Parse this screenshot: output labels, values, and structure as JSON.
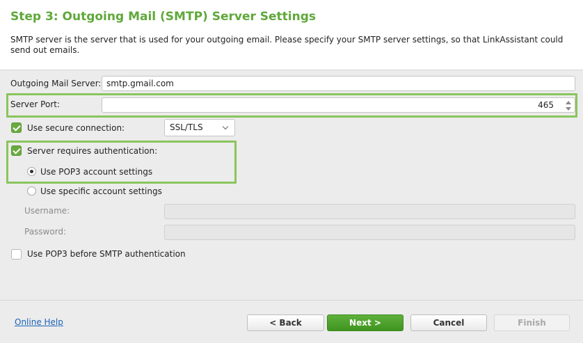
{
  "header": {
    "title": "Step 3: Outgoing Mail (SMTP) Server Settings",
    "description": "SMTP server is the server that is used for your outgoing email. Please specify your SMTP server settings, so that LinkAssistant could send out emails."
  },
  "form": {
    "outgoing_server_label": "Outgoing Mail Server:",
    "outgoing_server_value": "smtp.gmail.com",
    "server_port_label": "Server Port:",
    "server_port_value": "465",
    "secure_connection_label": "Use secure connection:",
    "secure_connection_checked": true,
    "secure_connection_value": "SSL/TLS",
    "auth_label": "Server requires authentication:",
    "auth_checked": true,
    "use_pop3_settings_label": "Use POP3 account settings",
    "use_specific_settings_label": "Use specific account settings",
    "username_label": "Username:",
    "username_value": "",
    "password_label": "Password:",
    "password_value": "",
    "pop3_before_smtp_label": "Use POP3 before SMTP authentication",
    "pop3_before_smtp_checked": false
  },
  "footer": {
    "help_link": "Online Help",
    "back_label": "< Back",
    "next_label": "Next >",
    "cancel_label": "Cancel",
    "finish_label": "Finish"
  },
  "colors": {
    "accent": "#5fa83a",
    "highlight": "#8ac55c",
    "link": "#1a63b8"
  }
}
